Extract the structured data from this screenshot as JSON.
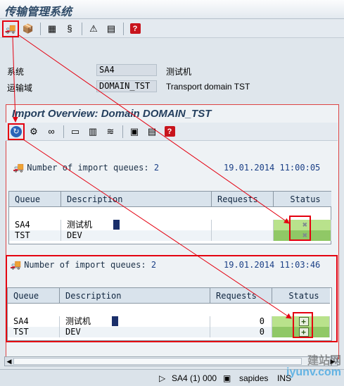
{
  "window": {
    "title": "传输管理系统"
  },
  "system": {
    "label": "系统",
    "value": "SA4",
    "desc": "测试机"
  },
  "domain": {
    "label": "运输域",
    "value": "DOMAIN_TST",
    "desc": "Transport domain TST"
  },
  "overview": {
    "title": "Import Overview: Domain DOMAIN_TST"
  },
  "sections": [
    {
      "label": "Number of import queues:",
      "count": "2",
      "timestamp": "19.01.2014 11:00:05",
      "columns": [
        "Queue",
        "Description",
        "Requests",
        "Status"
      ],
      "rows": [
        {
          "queue": "SA4",
          "description": "测试机",
          "requests": "",
          "status_icon": "x-icon"
        },
        {
          "queue": "TST",
          "description": "DEV",
          "requests": "",
          "status_icon": "x-icon"
        }
      ]
    },
    {
      "label": "Number of import queues:",
      "count": "2",
      "timestamp": "19.01.2014 11:03:46",
      "columns": [
        "Queue",
        "Description",
        "Requests",
        "Status"
      ],
      "rows": [
        {
          "queue": "SA4",
          "description": "测试机",
          "requests": "0",
          "status_icon": "plus-icon"
        },
        {
          "queue": "TST",
          "description": "DEV",
          "requests": "0",
          "status_icon": "plus-icon"
        }
      ]
    }
  ],
  "statusbar": {
    "system": "SA4 (1) 000",
    "host": "sapides",
    "mode": "INS"
  },
  "watermark": {
    "line1": "建站网",
    "line2": "iyunv.com"
  },
  "colors": {
    "highlight": "#e40010",
    "status_green": "#b9e28c"
  }
}
